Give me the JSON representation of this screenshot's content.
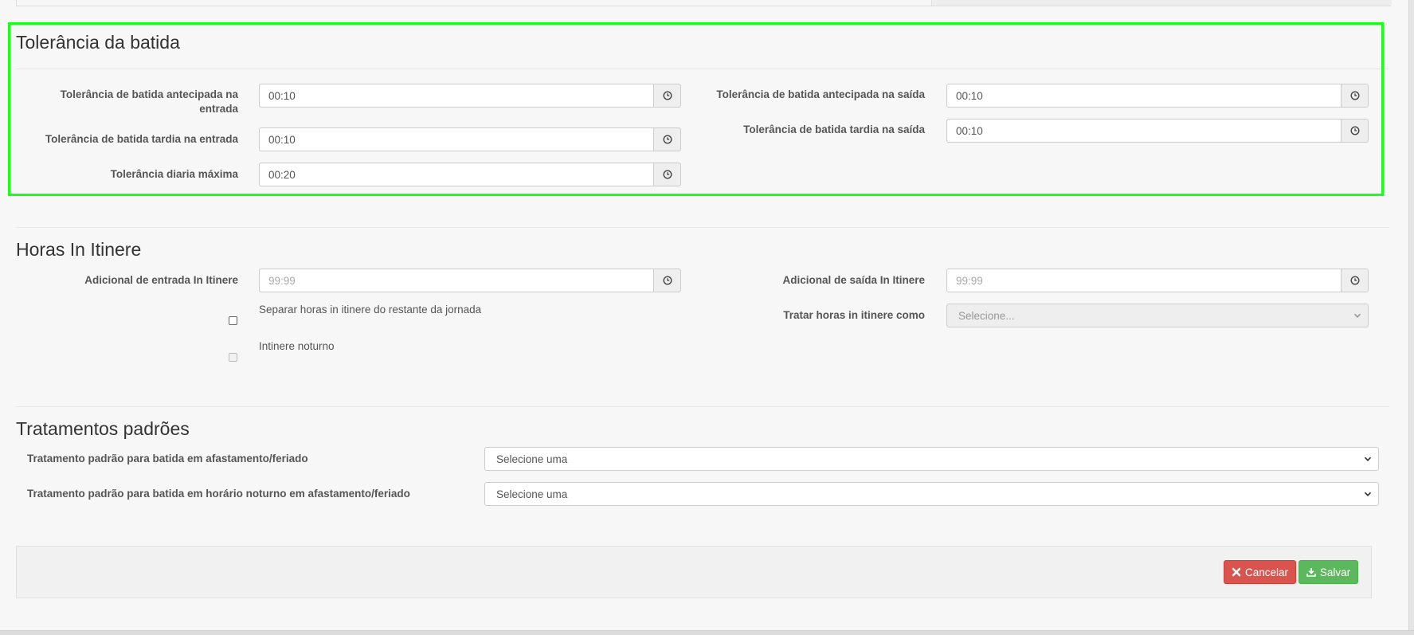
{
  "sections": {
    "tolerance": {
      "title": "Tolerância da batida",
      "fields": {
        "early_entry": {
          "label_line1": "Tolerância de batida antecipada na",
          "label_line2": "entrada",
          "value": "00:10"
        },
        "late_entry": {
          "label": "Tolerância de batida tardia na entrada",
          "value": "00:10"
        },
        "daily_max": {
          "label": "Tolerância diaria máxima",
          "value": "00:20"
        },
        "early_exit": {
          "label": "Tolerância de batida antecipada na saída",
          "value": "00:10"
        },
        "late_exit": {
          "label": "Tolerância de batida tardia na saída",
          "value": "00:10"
        }
      }
    },
    "in_itinere": {
      "title": "Horas In Itinere",
      "entry_label": "Adicional de entrada In Itinere",
      "entry_placeholder": "99:99",
      "exit_label": "Adicional de saída In Itinere",
      "exit_placeholder": "99:99",
      "separate_label": "Separar horas in itinere do restante da jornada",
      "night_label": "Intinere noturno",
      "treat_label": "Tratar horas in itinere como",
      "treat_placeholder": "Selecione..."
    },
    "default_treatments": {
      "title": "Tratamentos padrões",
      "leave_label": "Tratamento padrão para batida em afastamento/feriado",
      "leave_value": "Selecione uma",
      "night_leave_label": "Tratamento padrão para batida em horário noturno em afastamento/feriado",
      "night_leave_value": "Selecione uma"
    }
  },
  "actions": {
    "cancel_label": "Cancelar",
    "save_label": "Salvar"
  },
  "colors": {
    "highlight": "#1aff1a",
    "cancel": "#d9534f",
    "save": "#5cb85c"
  },
  "icons": [
    "clock-icon",
    "chevron-down-icon",
    "times-icon",
    "download-icon"
  ]
}
